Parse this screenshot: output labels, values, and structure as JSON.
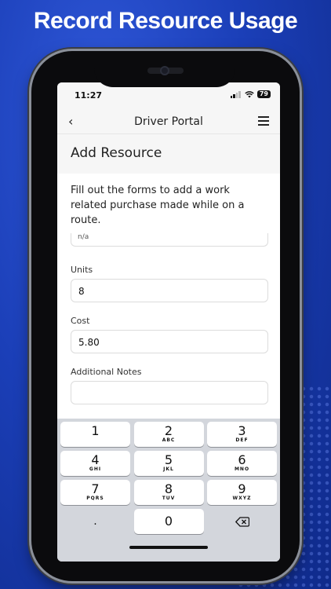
{
  "headline": "Record Resource Usage",
  "status_bar": {
    "time": "11:27",
    "battery": "79"
  },
  "nav": {
    "title": "Driver Portal",
    "back_icon": "chevron-left-icon",
    "menu_icon": "hamburger-icon"
  },
  "page": {
    "title": "Add Resource",
    "intro": "Fill out the forms to add a work related purchase made while on a route."
  },
  "form": {
    "partial_value": "n/a",
    "fields": [
      {
        "label": "Units",
        "value": "8"
      },
      {
        "label": "Cost",
        "value": "5.80"
      },
      {
        "label": "Additional Notes",
        "value": ""
      }
    ]
  },
  "keypad": {
    "rows": [
      [
        {
          "num": "1",
          "letters": ""
        },
        {
          "num": "2",
          "letters": "ABC"
        },
        {
          "num": "3",
          "letters": "DEF"
        }
      ],
      [
        {
          "num": "4",
          "letters": "GHI"
        },
        {
          "num": "5",
          "letters": "JKL"
        },
        {
          "num": "6",
          "letters": "MNO"
        }
      ],
      [
        {
          "num": "7",
          "letters": "PQRS"
        },
        {
          "num": "8",
          "letters": "TUV"
        },
        {
          "num": "9",
          "letters": "WXYZ"
        }
      ]
    ],
    "bottom": {
      "decimal": ".",
      "zero": "0",
      "delete_icon": "backspace-icon"
    }
  }
}
